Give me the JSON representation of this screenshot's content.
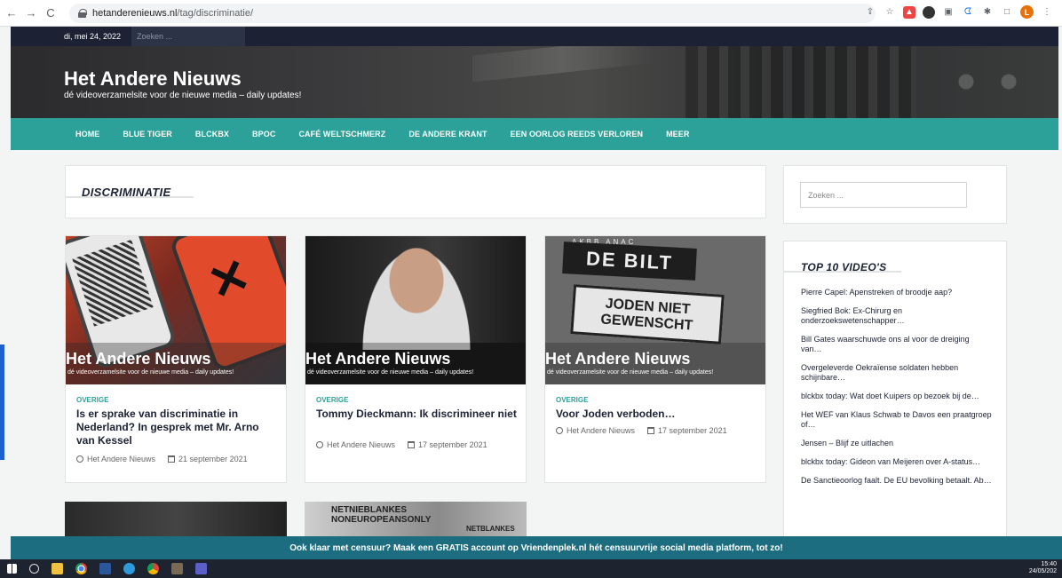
{
  "browser": {
    "url_host": "hetanderenieuws.nl",
    "url_path": "/tag/discriminatie/",
    "profile_initial": "L"
  },
  "topbar": {
    "date": "di, mei 24, 2022",
    "search_placeholder": "Zoeken ..."
  },
  "header": {
    "title": "Het Andere Nieuws",
    "tagline": "dé videoverzamelsite voor de nieuwe media – daily updates!"
  },
  "nav": {
    "items": [
      "HOME",
      "BLUE TIGER",
      "BLCKBX",
      "BPOC",
      "CAFÉ WELTSCHMERZ",
      "DE ANDERE KRANT",
      "EEN OORLOG REEDS VERLOREN",
      "MEER"
    ]
  },
  "tag": {
    "title": "DISCRIMINATIE"
  },
  "overlay": {
    "title": "Het Andere Nieuws",
    "sub": "dé videoverzamelsite voor de nieuwe media – daily updates!"
  },
  "images": {
    "card3_sign1": "DE BILT",
    "card3_sign2_line1": "JODEN NIET",
    "card3_sign2_line2": "GEWENSCHT",
    "card3_sign_small": "AKBB  ANAC",
    "card5_sign_line1": "NETNIEBLANKES",
    "card5_sign_line2": "NONEUROPEANSONLY",
    "card5_sign_right": "NETBLANKES"
  },
  "posts": [
    {
      "category": "OVERIGE",
      "title": "Is er sprake van discriminatie in Nederland? In gesprek met Mr. Arno van Kessel",
      "author": "Het Andere Nieuws",
      "date": "21 september 2021"
    },
    {
      "category": "OVERIGE",
      "title": "Tommy Dieckmann: Ik discrimineer niet",
      "author": "Het Andere Nieuws",
      "date": "17 september 2021"
    },
    {
      "category": "OVERIGE",
      "title": "Voor Joden verboden…",
      "author": "Het Andere Nieuws",
      "date": "17 september 2021"
    }
  ],
  "sidebar": {
    "search_placeholder": "Zoeken ...",
    "top10_title": "TOP 10 VIDEO'S",
    "top10": [
      "Pierre Capel: Apenstreken of broodje aap?",
      "Siegfried Bok: Ex-Chirurg en onderzoekswetenschapper…",
      "Bill Gates waarschuwde ons al voor de dreiging van…",
      "Overgeleverde Oekraïense soldaten hebben schijnbare…",
      "blckbx today: Wat doet Kuipers op bezoek bij de…",
      "Het WEF van Klaus Schwab te Davos een praatgroep of…",
      "Jensen – Blijf ze uitlachen",
      "blckbx today: Gideon van Meijeren over A-status…",
      "De Sanctieoorlog faalt. De EU bevolking betaalt. Ab…"
    ]
  },
  "banner": {
    "text": "Ook klaar met censuur? Maak een GRATIS account op Vriendenplek.nl hét censuurvrije social media platform, tot zo!"
  },
  "taskbar": {
    "time": "15:40",
    "date": "24/05/202"
  },
  "colors": {
    "nav_bg": "#2ca19a",
    "topbar_bg": "#1c2234",
    "banner_bg": "#1d6d80",
    "category": "#2ca19a"
  }
}
